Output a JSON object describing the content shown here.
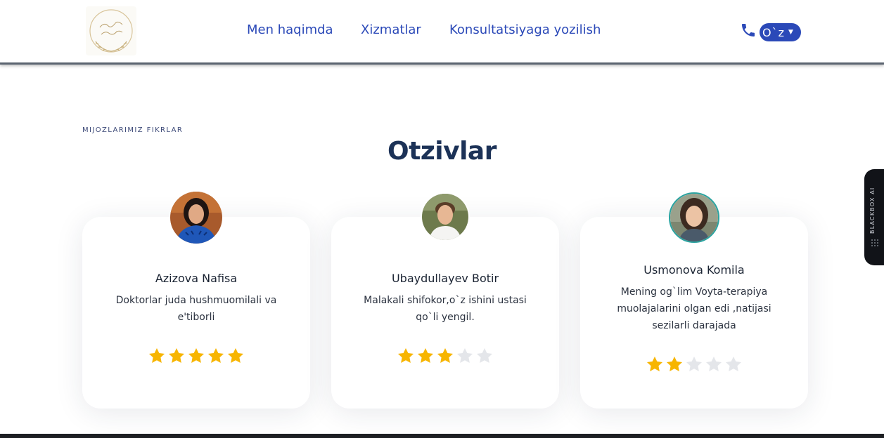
{
  "header": {
    "nav": [
      {
        "label": "Men haqimda"
      },
      {
        "label": "Xizmatlar"
      },
      {
        "label": "Konsultatsiyaga yozilish"
      }
    ],
    "language": "O`z",
    "icons": {
      "phone": "phone-icon",
      "chevron": "chevron-down-icon",
      "logo": "wreath-logo"
    }
  },
  "section": {
    "eyebrow": "MIJOZLARIMIZ FIKRLAR",
    "title": "Otzivlar"
  },
  "reviews": [
    {
      "name": "Azizova Nafisa",
      "text": "Doktorlar juda hushmuomilali va e'tiborli",
      "rating": 5,
      "max_rating": 5
    },
    {
      "name": "Ubaydullayev Botir",
      "text": "Malakali shifokor,o`z ishini ustasi qo`li yengil.",
      "rating": 3,
      "max_rating": 5
    },
    {
      "name": "Usmonova Komila",
      "text": "Mening og`lim Voyta-terapiya muolajalarini olgan edi ,natijasi sezilarli darajada",
      "rating": 2,
      "max_rating": 5
    }
  ],
  "side_widget": {
    "label": "BLACKBOX AI"
  },
  "colors": {
    "accent": "#2b49b8",
    "title": "#1c3257",
    "star_filled": "#f7b500",
    "star_empty": "#e4e6ea"
  }
}
